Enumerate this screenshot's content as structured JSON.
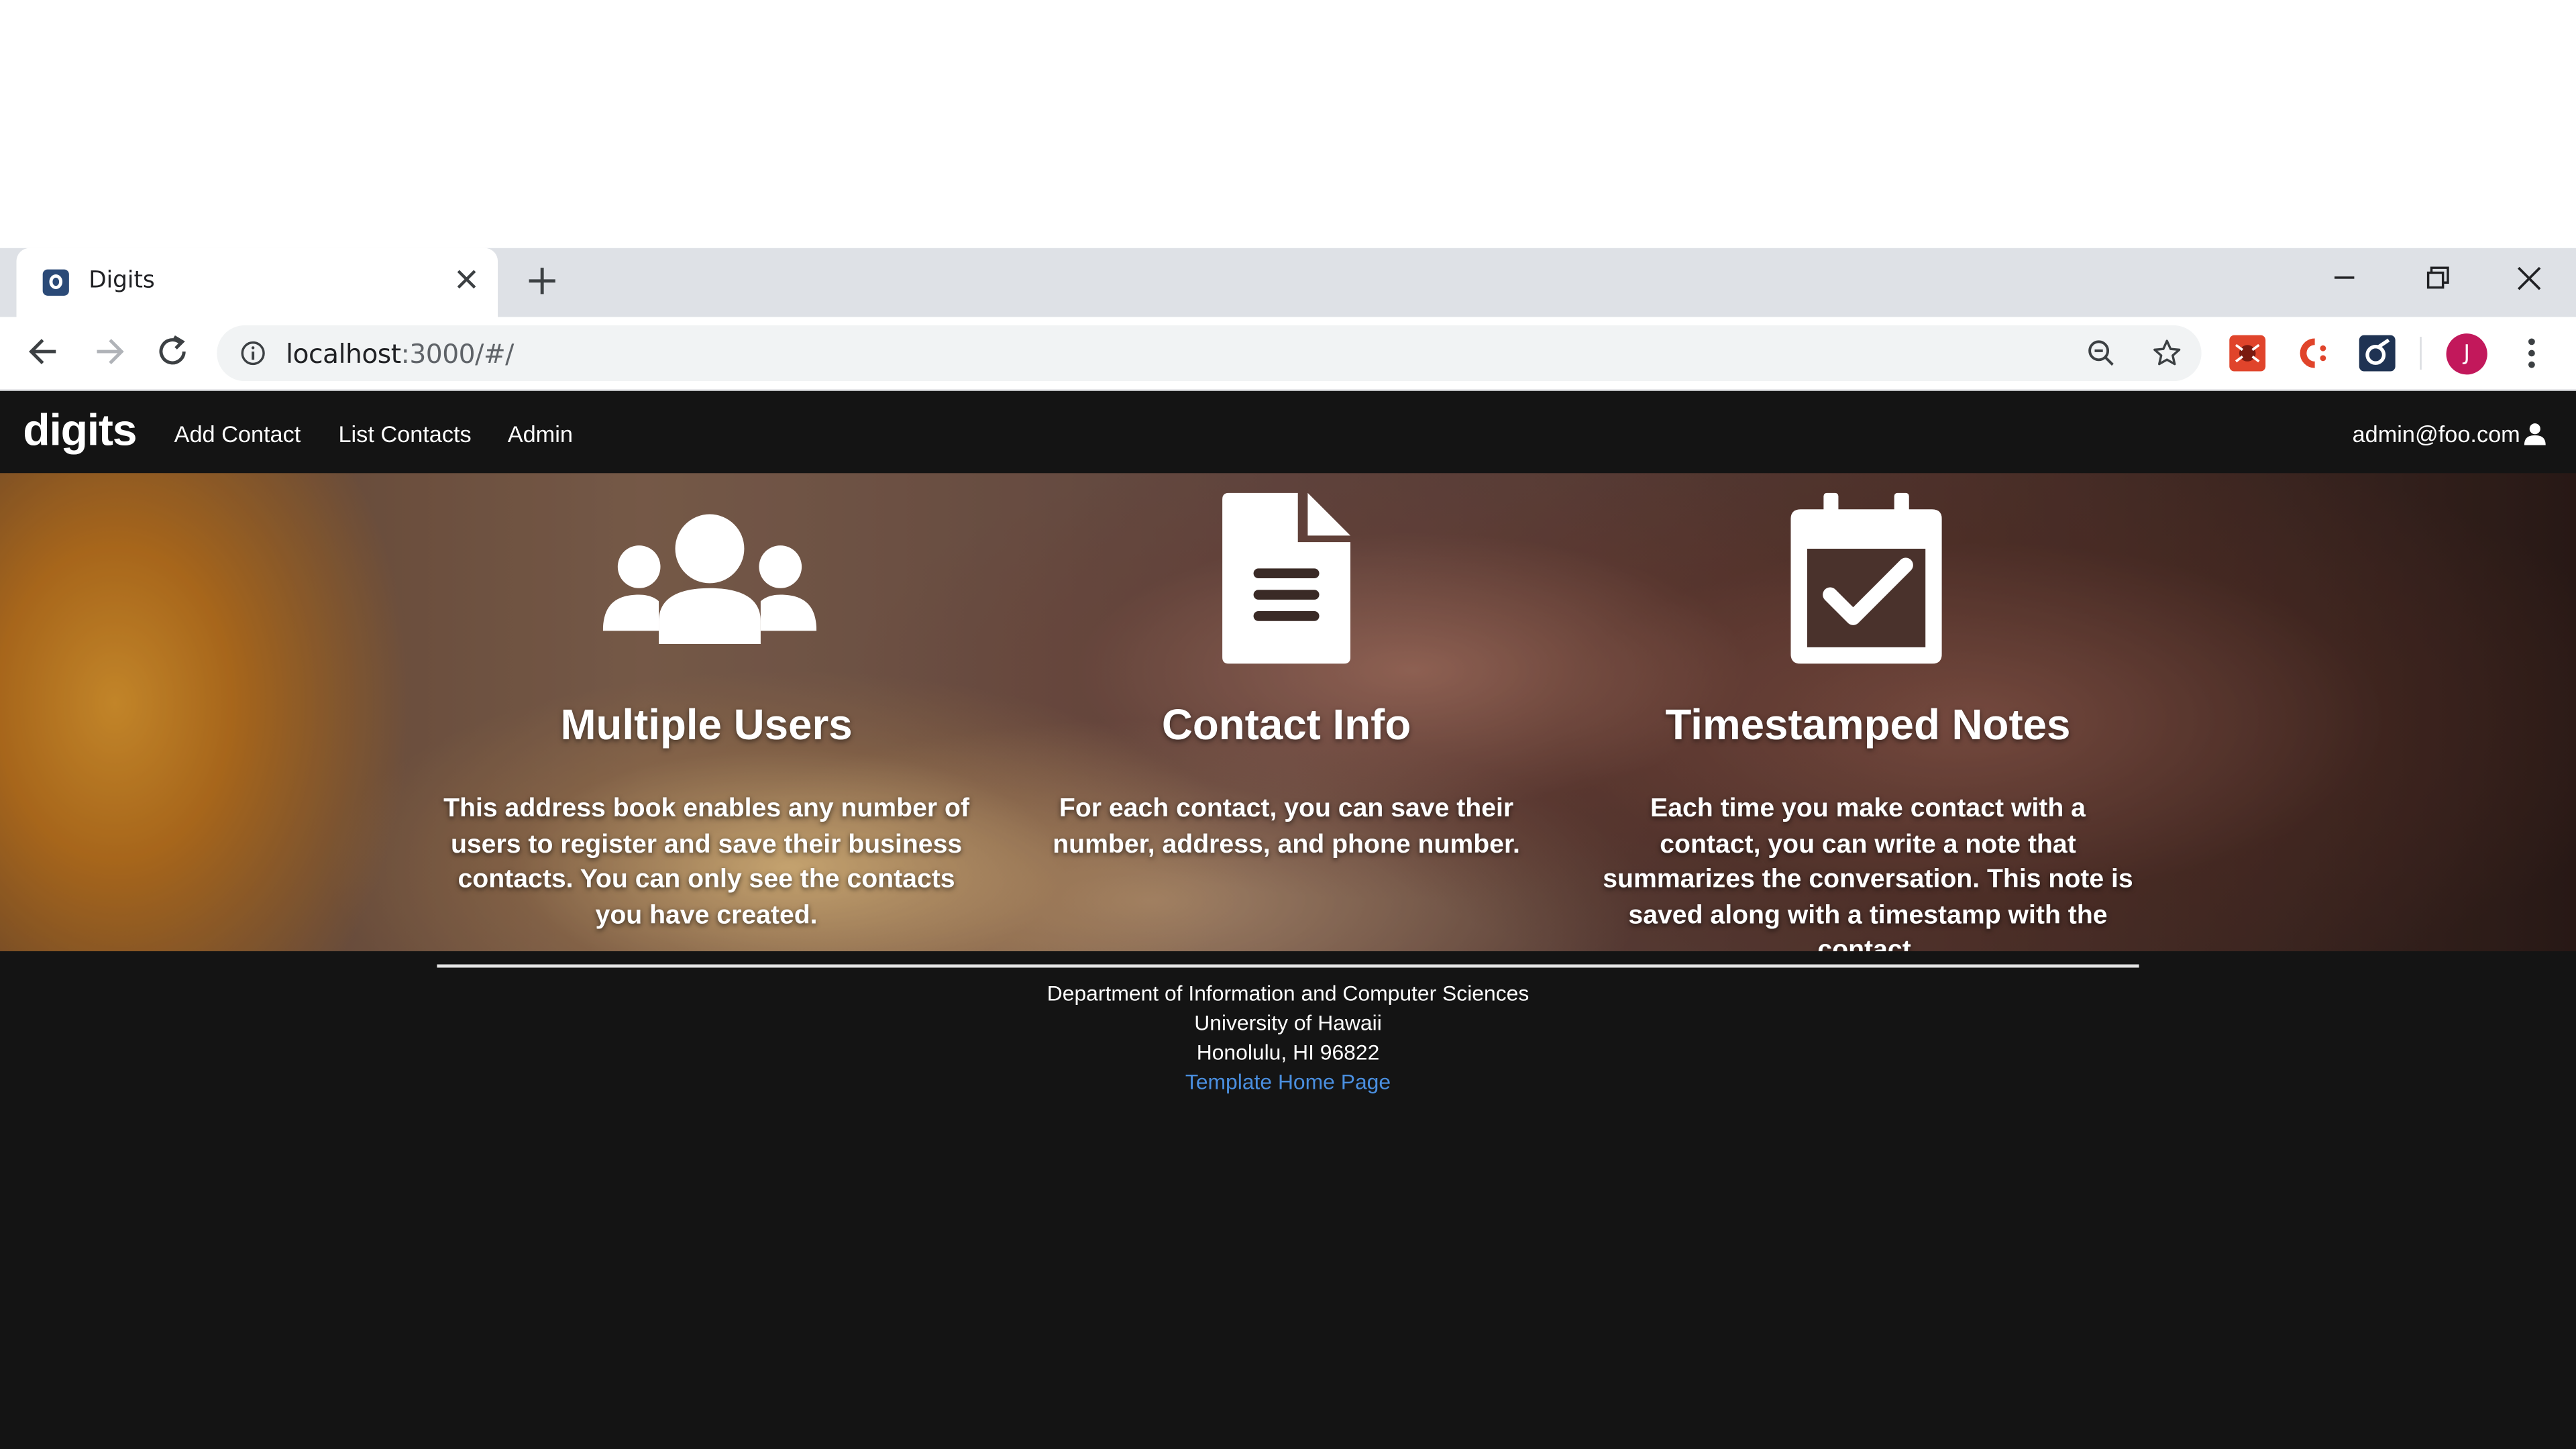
{
  "browser": {
    "tab_title": "Digits",
    "url_host": "localhost",
    "url_rest": ":3000/#/",
    "profile_initial": "J"
  },
  "navbar": {
    "brand": "digits",
    "links": [
      "Add Contact",
      "List Contacts",
      "Admin"
    ],
    "user": "admin@foo.com"
  },
  "features": [
    {
      "icon": "users-icon",
      "title": "Multiple Users",
      "text": "This address book enables any number of users to register and save their business contacts. You can only see the contacts you have created."
    },
    {
      "icon": "file-icon",
      "title": "Contact Info",
      "text": "For each contact, you can save their number, address, and phone number."
    },
    {
      "icon": "calendar-check-icon",
      "title": "Timestamped Notes",
      "text": "Each time you make contact with a contact, you can write a note that summarizes the conversation. This note is saved along with a timestamp with the contact."
    }
  ],
  "footer": {
    "line1": "Department of Information and Computer Sciences",
    "line2": "University of Hawaii",
    "line3": "Honolulu, HI 96822",
    "link": "Template Home Page"
  },
  "colors": {
    "navbar_bg": "#141414",
    "link": "#4a8fe0",
    "avatar": "#c2185b"
  }
}
